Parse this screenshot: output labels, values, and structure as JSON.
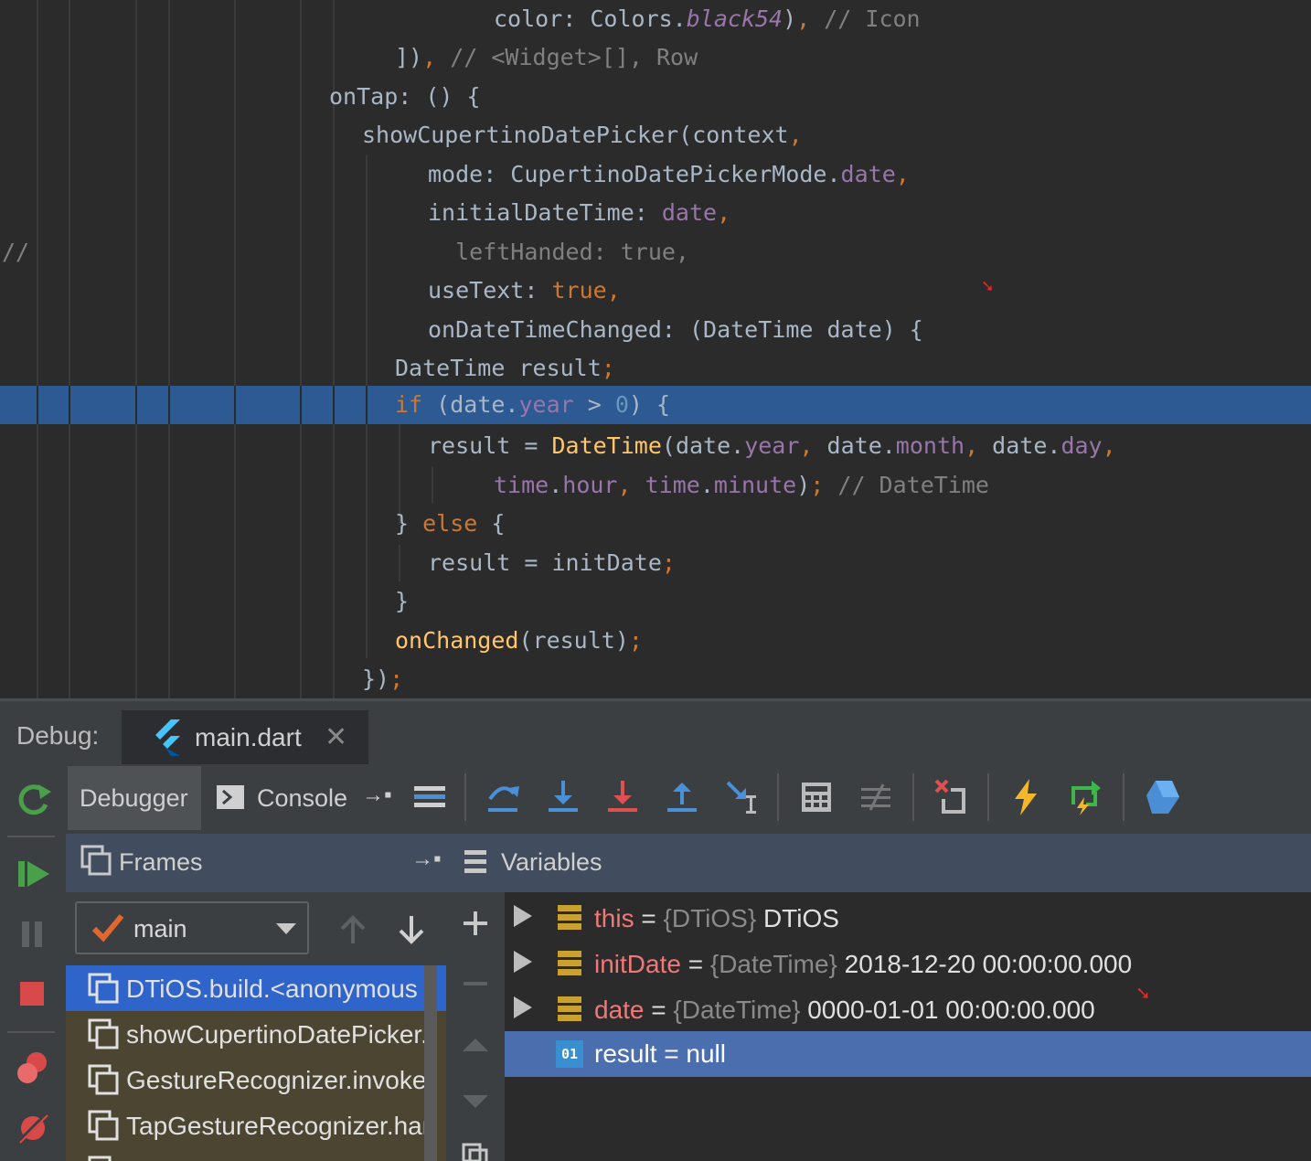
{
  "editor": {
    "lines": [
      {
        "segments": [
          [
            "",
            "color: Colors."
          ],
          [
            "fld it",
            "black54"
          ],
          [
            "",
            ")"
          ],
          [
            "kw",
            ","
          ],
          [
            "cmt",
            " // Icon"
          ]
        ]
      },
      {
        "segments": [
          [
            "",
            "])"
          ],
          [
            "kw",
            ","
          ],
          [
            "cmt",
            " // <Widget>[], Row"
          ]
        ]
      },
      {
        "segments": [
          [
            "",
            "onTap: () {"
          ]
        ]
      },
      {
        "segments": [
          [
            "",
            "showCupertinoDatePicker(context"
          ],
          [
            "kw",
            ","
          ]
        ]
      },
      {
        "segments": [
          [
            "",
            "mode: CupertinoDatePickerMode."
          ],
          [
            "fld",
            "date"
          ],
          [
            "kw",
            ","
          ]
        ]
      },
      {
        "segments": [
          [
            "",
            "initialDateTime: "
          ],
          [
            "fld",
            "date"
          ],
          [
            "kw",
            ","
          ]
        ]
      },
      {
        "segments": [
          [
            "cmt",
            "  leftHanded: true,"
          ]
        ]
      },
      {
        "segments": [
          [
            "",
            "useText: "
          ],
          [
            "kw",
            "true"
          ],
          [
            "kw",
            ","
          ]
        ]
      },
      {
        "segments": [
          [
            "",
            "onDateTimeChanged: (DateTime date) {"
          ]
        ]
      },
      {
        "segments": [
          [
            "",
            "DateTime result"
          ],
          [
            "kw",
            ";"
          ]
        ]
      },
      {
        "segments": [
          [
            "kw",
            "if"
          ],
          [
            "",
            " (date."
          ],
          [
            "fld",
            "year"
          ],
          [
            "",
            " > "
          ],
          [
            "num",
            "0"
          ],
          [
            "",
            ") {"
          ]
        ]
      },
      {
        "segments": [
          [
            "",
            "result = "
          ],
          [
            "fn",
            "DateTime"
          ],
          [
            "",
            "(date."
          ],
          [
            "fld",
            "year"
          ],
          [
            "kw",
            ","
          ],
          [
            "",
            " date."
          ],
          [
            "fld",
            "month"
          ],
          [
            "kw",
            ","
          ],
          [
            "",
            " date."
          ],
          [
            "fld",
            "day"
          ],
          [
            "kw",
            ","
          ]
        ]
      },
      {
        "segments": [
          [
            "fld",
            "time"
          ],
          [
            "",
            "."
          ],
          [
            "fld",
            "hour"
          ],
          [
            "kw",
            ","
          ],
          [
            "",
            " "
          ],
          [
            "fld",
            "time"
          ],
          [
            "",
            "."
          ],
          [
            "fld",
            "minute"
          ],
          [
            "",
            ")"
          ],
          [
            "kw",
            ";"
          ],
          [
            "cmt",
            " // DateTime"
          ]
        ]
      },
      {
        "segments": [
          [
            "",
            "} "
          ],
          [
            "kw",
            "else"
          ],
          [
            "",
            " {"
          ]
        ]
      },
      {
        "segments": [
          [
            "",
            "result = initDate"
          ],
          [
            "kw",
            ";"
          ]
        ]
      },
      {
        "segments": [
          [
            "",
            "}"
          ]
        ]
      },
      {
        "segments": [
          [
            "fn",
            "onChanged"
          ],
          [
            "",
            "(result)"
          ],
          [
            "kw",
            ";"
          ]
        ]
      },
      {
        "segments": [
          [
            "",
            "})"
          ],
          [
            "kw",
            ";"
          ]
        ]
      }
    ],
    "gutter_comment": "//"
  },
  "debug": {
    "label": "Debug:",
    "tab_file": "main.dart",
    "tabs": {
      "debugger": "Debugger",
      "console": "Console"
    },
    "frames_title": "Frames",
    "variables_title": "Variables",
    "thread": "main",
    "frames": [
      "DTiOS.build.<anonymous",
      "showCupertinoDatePicker.",
      "GestureRecognizer.invoke(",
      "TapGestureRecognizer.han"
    ],
    "variables": [
      {
        "name": "this",
        "eq": " = ",
        "type": "{DTiOS}",
        "value": " DTiOS"
      },
      {
        "name": "initDate",
        "eq": " = ",
        "type": "{DateTime}",
        "value": " 2018-12-20 00:00:00.000"
      },
      {
        "name": "date",
        "eq": " = ",
        "type": "{DateTime}",
        "value": " 0000-01-01 00:00:00.000"
      },
      {
        "name": "result",
        "eq": " = ",
        "type": "",
        "value": "null",
        "badge": "01"
      }
    ]
  },
  "colors": {
    "accent_selected": "#2f65ca",
    "variable_selected": "#4b6eaf",
    "line_highlight": "#2d5a92"
  }
}
